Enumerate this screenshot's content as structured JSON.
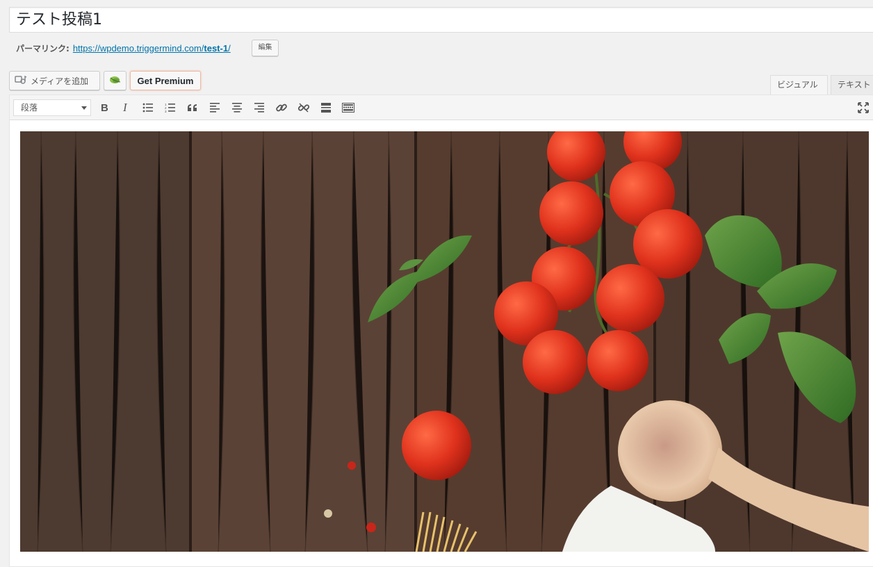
{
  "post": {
    "title": "テスト投稿1",
    "permalink_label": "パーマリンク:",
    "permalink_base": "https://wpdemo.triggermind.com/",
    "permalink_slug": "test-1",
    "permalink_trailing": "/",
    "edit_label": "編集"
  },
  "media_buttons": {
    "add_media": "メディアを追加",
    "premium": "Get Premium"
  },
  "editor_tabs": {
    "visual": "ビジュアル",
    "text": "テキスト"
  },
  "toolbar": {
    "format_value": "段落",
    "buttons": [
      "bold",
      "italic",
      "bulleted-list",
      "numbered-list",
      "blockquote",
      "align-left",
      "align-center",
      "align-right",
      "insert-link",
      "remove-link",
      "read-more",
      "toolbar-toggle",
      "fullscreen"
    ]
  },
  "content": {
    "image_subject": "wooden table with cherry tomatoes, basil, wooden spoon, cloth and spaghetti"
  },
  "colors": {
    "link": "#0073aa",
    "premium_border": "#f0b9a0"
  }
}
